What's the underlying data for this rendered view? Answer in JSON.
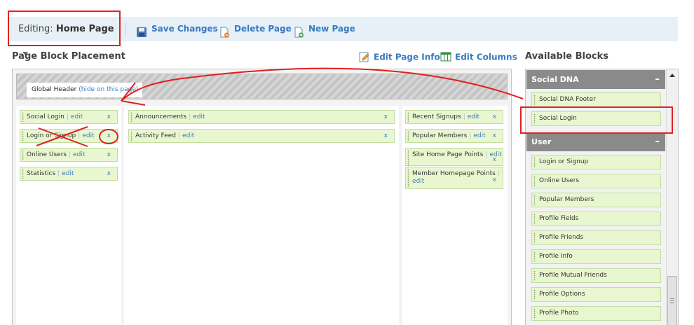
{
  "toolbar": {
    "editing_label": "Editing:",
    "page_name": "Home Page",
    "save_label": "Save Changes",
    "delete_label": "Delete Page",
    "new_label": "New Page"
  },
  "placement": {
    "heading": "Page Block Placement",
    "edit_page_info": "Edit Page Info",
    "edit_columns": "Edit Columns",
    "global_header": "Global Header",
    "hide_link": "(hide on this page)",
    "edit_label": "edit",
    "remove_label": "x",
    "sep": "|",
    "left_column": [
      "Social Login",
      "Login or Signup",
      "Online Users",
      "Statistics"
    ],
    "middle_column": [
      "Announcements",
      "Activity Feed"
    ],
    "right_column": [
      "Recent Signups",
      "Popular Members",
      "Site Home Page Points",
      "Member Homepage Points"
    ]
  },
  "available": {
    "heading": "Available Blocks",
    "groups": [
      {
        "name": "Social DNA",
        "collapse": "–",
        "blocks": [
          "Social DNA Footer",
          "Social Login"
        ]
      },
      {
        "name": "User",
        "collapse": "–",
        "blocks": [
          "Login or Signup",
          "Online Users",
          "Popular Members",
          "Profile Fields",
          "Profile Friends",
          "Profile Info",
          "Profile Mutual Friends",
          "Profile Options",
          "Profile Photo"
        ]
      }
    ]
  },
  "colors": {
    "accent": "#3a7abf",
    "annotation": "#e02020",
    "block_bg": "#e9f7d0",
    "group_header": "#8a8a8a"
  }
}
